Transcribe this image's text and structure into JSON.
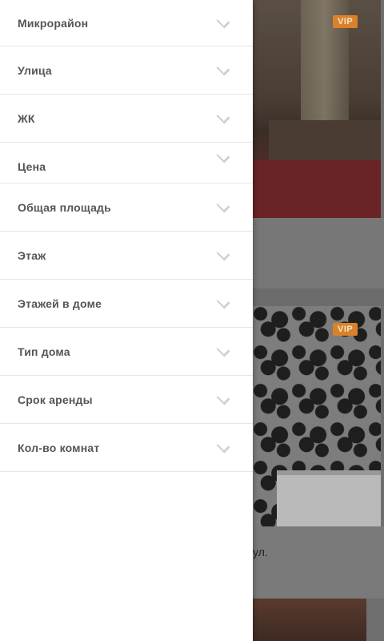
{
  "filters": [
    {
      "label": "Микрорайон"
    },
    {
      "label": "Улица"
    },
    {
      "label": "ЖК"
    },
    {
      "label": "Цена"
    },
    {
      "label": "Общая площадь"
    },
    {
      "label": "Этаж"
    },
    {
      "label": "Этажей в доме"
    },
    {
      "label": "Тип дома"
    },
    {
      "label": "Срок аренды"
    },
    {
      "label": "Кол-во комнат"
    }
  ],
  "listings": [
    {
      "badge": "VIP"
    },
    {
      "badge": "VIP",
      "caption_fragment": "ул."
    }
  ]
}
